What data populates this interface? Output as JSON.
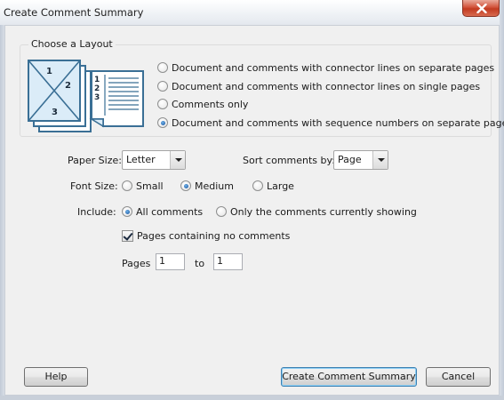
{
  "window": {
    "title": "Create Comment Summary"
  },
  "layout": {
    "legend": "Choose a Layout",
    "options": [
      {
        "label": "Document and comments with connector lines on separate pages",
        "checked": false
      },
      {
        "label": "Document and comments with connector lines on single pages",
        "checked": false
      },
      {
        "label": "Comments only",
        "checked": false
      },
      {
        "label": "Document and comments with sequence numbers on separate pages",
        "checked": true
      }
    ],
    "icon": {
      "name": "layout-preview-icon",
      "numbers": [
        "1",
        "2",
        "3"
      ]
    }
  },
  "paper_size": {
    "label": "Paper Size:",
    "value": "Letter"
  },
  "sort": {
    "label": "Sort comments by:",
    "value": "Page"
  },
  "font_size": {
    "label": "Font Size:",
    "options": [
      {
        "label": "Small",
        "checked": false
      },
      {
        "label": "Medium",
        "checked": true
      },
      {
        "label": "Large",
        "checked": false
      }
    ]
  },
  "include": {
    "label": "Include:",
    "options": [
      {
        "label": "All comments",
        "checked": true
      },
      {
        "label": "Only the comments currently showing",
        "checked": false
      }
    ]
  },
  "no_comment_pages": {
    "label": "Pages containing no comments",
    "checked": true
  },
  "pages": {
    "label": "Pages",
    "to_label": "to",
    "from": "1",
    "to": "1"
  },
  "buttons": {
    "help": "Help",
    "create": "Create Comment Summary",
    "cancel": "Cancel"
  },
  "colors": {
    "close": "#c23a20",
    "radio_dot": "#15509b",
    "default_button_border": "#3c7fb1"
  }
}
